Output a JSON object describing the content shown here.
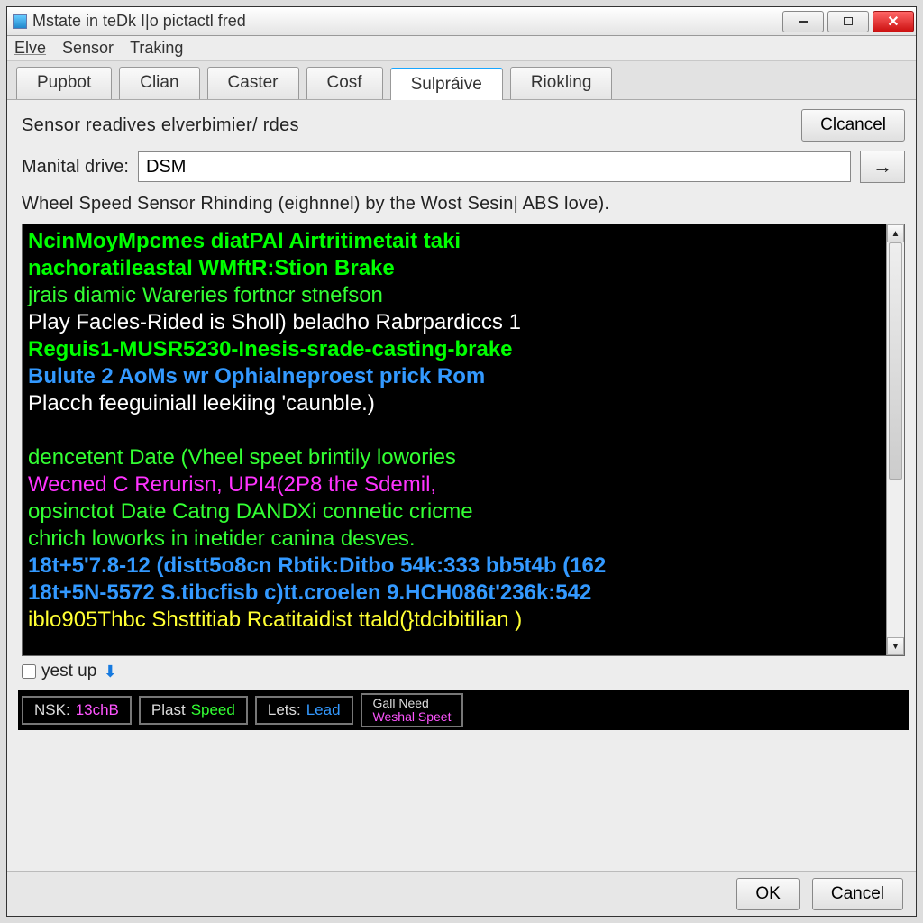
{
  "window": {
    "title": "Mstate in teDk I|o pictactl fred"
  },
  "menubar": {
    "items": [
      "Elve",
      "Sensor",
      "Traking"
    ]
  },
  "tabs": {
    "items": [
      "Pupbot",
      "Clian",
      "Caster",
      "Cosf",
      "Sulpráive",
      "Riokling"
    ],
    "active_index": 4
  },
  "header": {
    "section_label": "Sensor readives elverbimier/ rdes",
    "cancel_top": "Clcancel"
  },
  "drive": {
    "label": "Manital drive:",
    "value": "DSM",
    "placeholder": ""
  },
  "desc": "Wheel Speed Sensor Rhinding (eighnnel) by the Wost Sesin| ABS love).",
  "console_lines": [
    {
      "cls": "g",
      "text": "NcinMoyMpcmes diatPAl Airtritimetait taki"
    },
    {
      "cls": "g",
      "text": "nachoratileastal WMftR:Stion Brake"
    },
    {
      "cls": "g2",
      "text": "jrais diamic Wareries fortncr stnefson"
    },
    {
      "cls": "w",
      "text": "Play Facles-Rided is Sholl) beladho Rabrpardiccs 1"
    },
    {
      "cls": "g",
      "text": "Reguis1-MUSR5230-Inesis-srade-casting-brake"
    },
    {
      "cls": "b",
      "text": "Bulute 2 AoMs wr Ophialneproest prick Rom"
    },
    {
      "cls": "w",
      "text": "Placch feeguiniall leekiing 'caunble.)"
    },
    {
      "cls": "w",
      "text": " "
    },
    {
      "cls": "g2",
      "text": "dencetent Date (Vheel speet brintily lowories"
    },
    {
      "cls": "m",
      "text": "Wecned C Rerurisn, UPI4(2P8 the Sdemil,"
    },
    {
      "cls": "g2",
      "text": "opsinctot Date Catng DANDXi connetic cricme"
    },
    {
      "cls": "g2",
      "text": "chrich loworks in inetider canina desves."
    },
    {
      "cls": "b",
      "text": "18t+5'7.8-12 (distt5o8cn Rbtik:Ditbo 54k:333 bb5t4b (162"
    },
    {
      "cls": "b",
      "text": "18t+5N-5572 S.tibcfisb c)tt.croelen 9.HCH086t'236k:542"
    },
    {
      "cls": "y",
      "text": "iblo905Thbc Shsttitiab Rcatitaidist ttald(}tdcibitilian )"
    }
  ],
  "checkbox": {
    "label": "yest up"
  },
  "info_strip": [
    {
      "label": "NSK:",
      "value": "13chB",
      "value_cls": "v1"
    },
    {
      "label": "Plast",
      "value": "Speed",
      "value_cls": "v2"
    },
    {
      "label": "Lets:",
      "value": "Lead",
      "value_cls": "v3"
    },
    {
      "top": "Gall Need",
      "bottom": "Weshal Speet"
    }
  ],
  "footer": {
    "ok": "OK",
    "cancel": "Cancel"
  }
}
